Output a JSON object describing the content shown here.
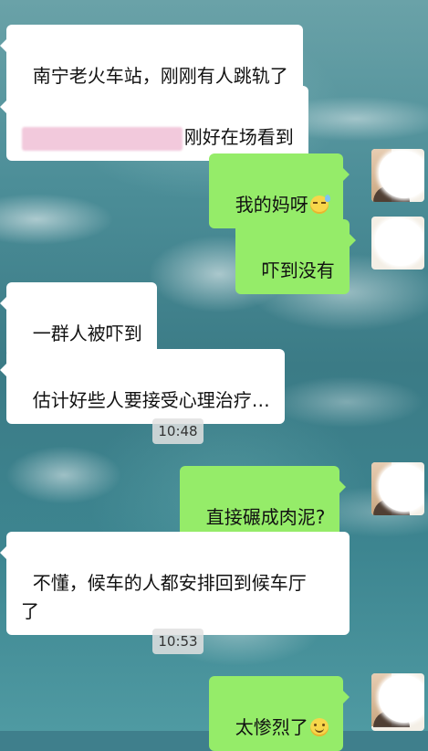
{
  "messages": [
    {
      "side": "left",
      "text": "南宁老火车站，刚刚有人跳轨了"
    },
    {
      "side": "left",
      "text": "刚好在场看到",
      "redacted_prefix": true
    },
    {
      "side": "right",
      "text": "我的妈呀",
      "emoji": "sweat-smile-icon"
    },
    {
      "side": "right",
      "text": "吓到没有"
    },
    {
      "side": "left",
      "text": "一群人被吓到"
    },
    {
      "side": "left",
      "text": "估计好些人要接受心理治疗…"
    },
    {
      "side": "time",
      "text": "10:48"
    },
    {
      "side": "right",
      "text": "直接碾成肉泥?"
    },
    {
      "side": "left",
      "text": "不懂，候车的人都安排回到候车厅\n了"
    },
    {
      "side": "time",
      "text": "10:53"
    },
    {
      "side": "right",
      "text": "太惨烈了",
      "emoji": "smile-icon"
    }
  ],
  "colors": {
    "incoming_bubble": "#ffffff",
    "outgoing_bubble": "#95ec69",
    "timestamp_bg": "#e1e1e1",
    "redaction": "#f2c9dc"
  }
}
